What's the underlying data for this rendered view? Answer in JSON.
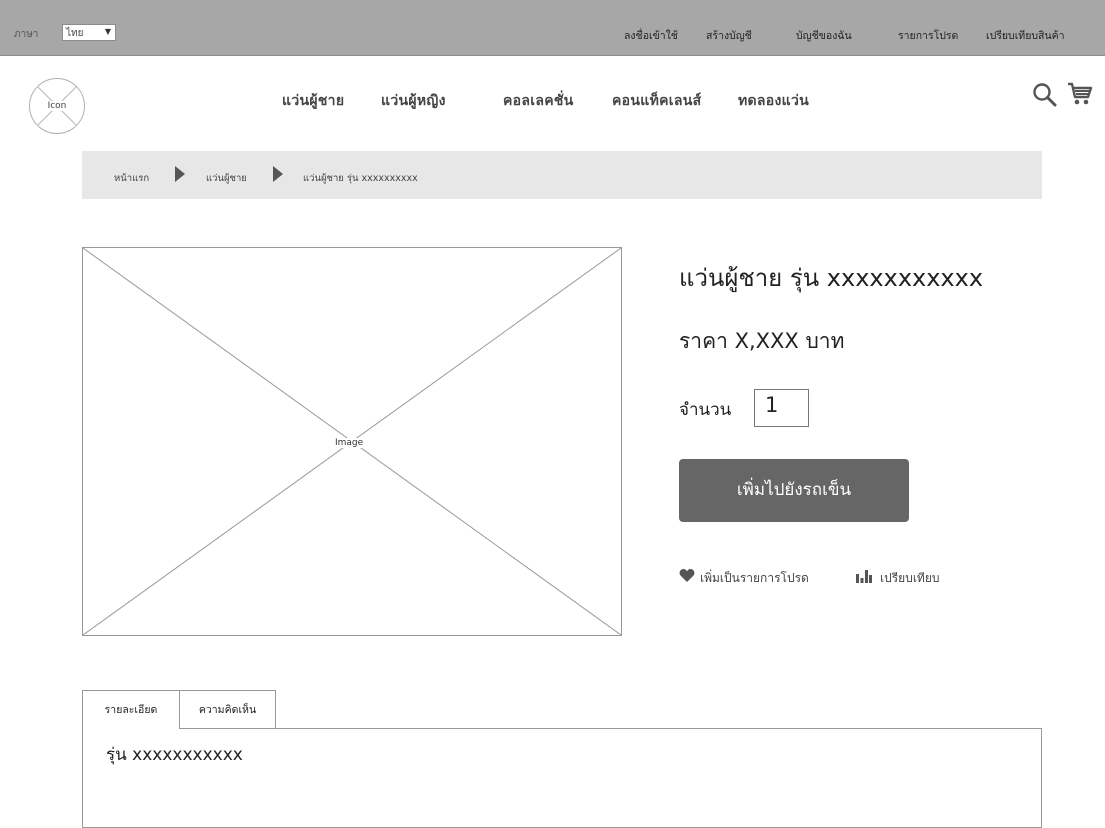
{
  "topbar": {
    "language_label": "ภาษา",
    "language_value": "ไทย",
    "links": [
      "ลงชื่อเข้าใช้",
      "สร้างบัญชี",
      "บัญชีของฉัน",
      "รายการโปรด",
      "เปรียบเทียบสินค้า"
    ]
  },
  "logo": {
    "label": "Icon"
  },
  "nav": {
    "items": [
      "แว่นผู้ชาย",
      "แว่นผู้หญิง",
      "คอลเลคชั่น",
      "คอนแท็คเลนส์",
      "ทดลองแว่น"
    ],
    "icons": [
      "search-icon",
      "cart-icon"
    ]
  },
  "breadcrumb": [
    "หน้าแรก",
    "แว่นผู้ชาย",
    "แว่นผู้ชาย รุ่น xxxxxxxxxx"
  ],
  "product": {
    "image_label": "Image",
    "title": "แว่นผู้ชาย รุ่น xxxxxxxxxxx",
    "price": "ราคา X,XXX บาท",
    "quantity_label": "จำนวน",
    "quantity_value": "1",
    "add_to_cart": "เพิ่มไปยังรถเข็น",
    "favorite": "เพิ่มเป็นรายการโปรด",
    "compare": "เปรียบเทียบ"
  },
  "tabs": {
    "items": [
      "รายละเอียด",
      "ความคิดเห็น"
    ],
    "active": "รายละเอียด",
    "content": "รุ่น xxxxxxxxxxx"
  },
  "colors": {
    "topbar": "#a7a7a7",
    "breadcrumb_bg": "#e7e7e7",
    "button": "#666666"
  }
}
